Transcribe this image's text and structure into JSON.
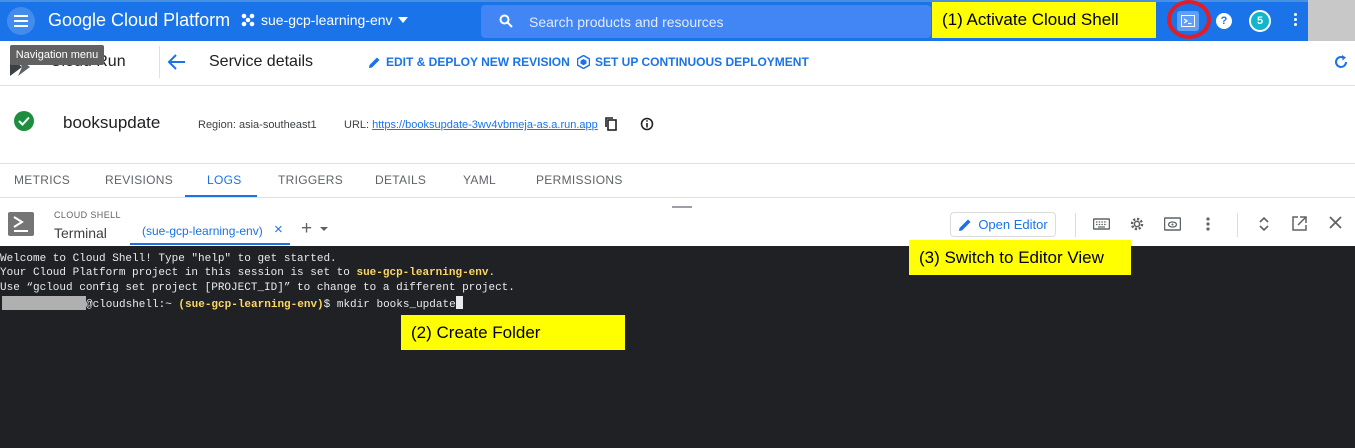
{
  "topbar": {
    "brand": "Google Cloud Platform",
    "project": "sue-gcp-learning-env",
    "search_placeholder": "Search products and resources",
    "badge": "5",
    "help_label": "?"
  },
  "tooltip": "Navigation menu",
  "service_header": {
    "product": "Cloud Run",
    "page_title": "Service details",
    "actions": {
      "edit_deploy": "EDIT & DEPLOY NEW REVISION",
      "continuous_deploy": "SET UP CONTINUOUS DEPLOYMENT"
    }
  },
  "service_info": {
    "name": "booksupdate",
    "region": "Region: asia-southeast1",
    "url_label": "URL:",
    "url": "https://booksupdate-3wv4vbmeja-as.a.run.app"
  },
  "tabs": [
    {
      "label": "METRICS"
    },
    {
      "label": "REVISIONS"
    },
    {
      "label": "LOGS"
    },
    {
      "label": "TRIGGERS"
    },
    {
      "label": "DETAILS"
    },
    {
      "label": "YAML"
    },
    {
      "label": "PERMISSIONS"
    }
  ],
  "cloud_shell": {
    "title": "CLOUD SHELL",
    "subtitle": "Terminal",
    "session_tab": "(sue-gcp-learning-env)",
    "close_glyph": "×",
    "plus_glyph": "+",
    "open_editor": "Open Editor"
  },
  "terminal": {
    "line1": "Welcome to Cloud Shell! Type \"help\" to get started.",
    "line2_prefix": "Your Cloud Platform project in this session is set to ",
    "line2_project": "sue-gcp-learning-env",
    "line2_suffix": ".",
    "line3": "Use “gcloud config set project [PROJECT_ID]” to change to a different project.",
    "prompt_host": "@cloudshell:~ ",
    "prompt_project": "(sue-gcp-learning-env)",
    "prompt_symbol": "$ ",
    "command": "mkdir books_update"
  },
  "annotations": {
    "step1": "(1) Activate Cloud Shell",
    "step2": "(2) Create Folder",
    "step3": "(3) Switch to Editor View"
  },
  "colors": {
    "topbar": "#1a73e8",
    "accent": "#1a73e8",
    "success": "#1e8e3e",
    "terminal_bg": "#202124",
    "prompt_yellow": "#fdd663",
    "callout_bg": "#ffff00",
    "highlight_ring": "#e51c23"
  }
}
